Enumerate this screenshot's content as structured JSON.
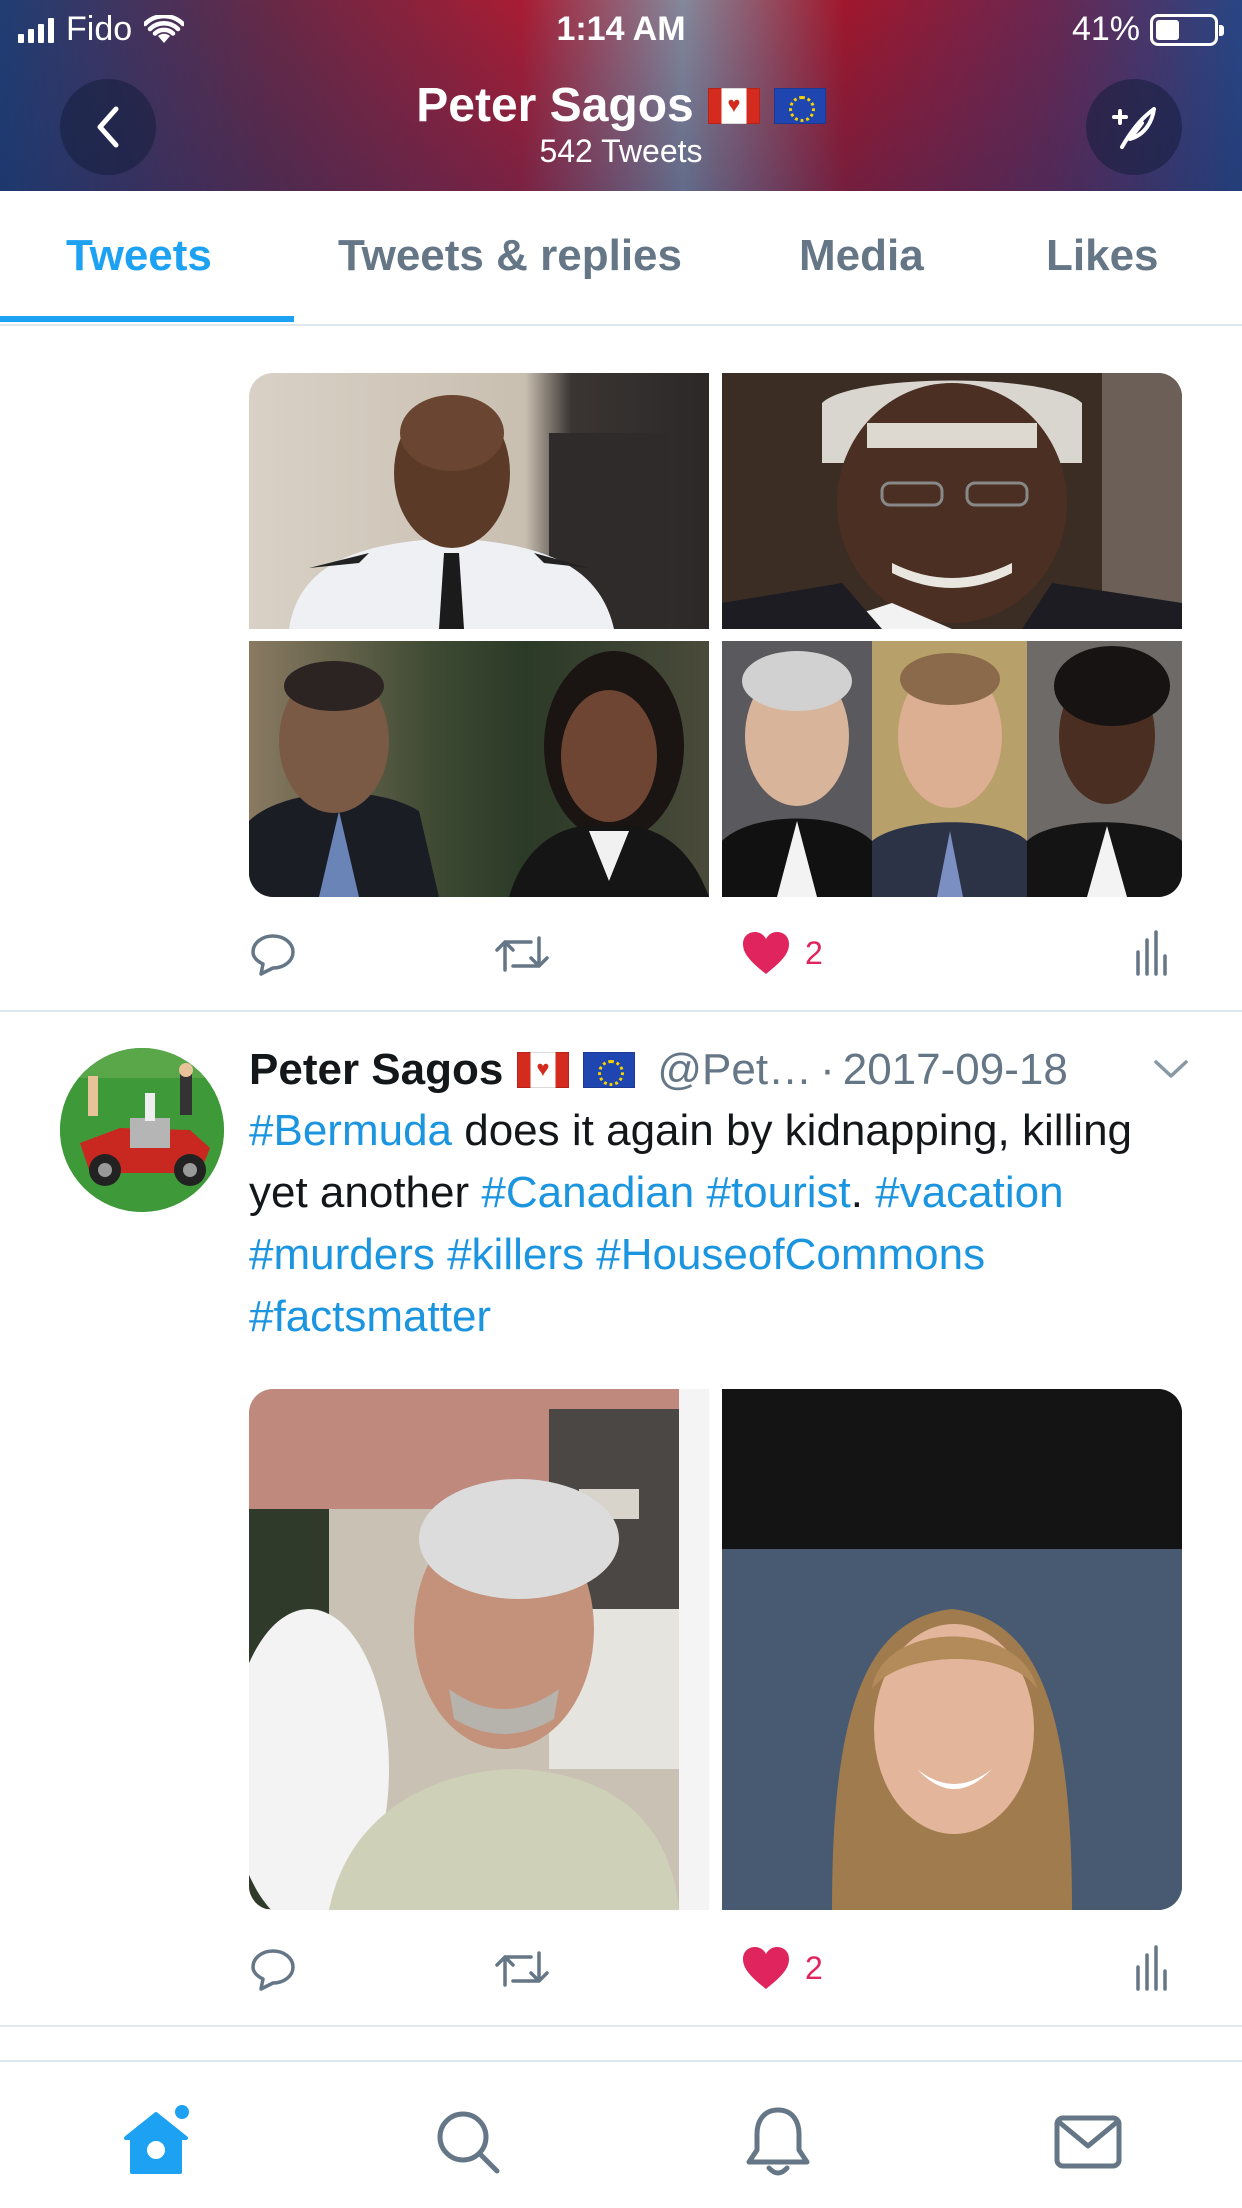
{
  "status_bar": {
    "carrier": "Fido",
    "time": "1:14 AM",
    "battery": "41%",
    "battery_level": 0.41
  },
  "header": {
    "name": "Peter Sagos",
    "tweet_count": "542 Tweets",
    "flags": [
      "canada-flag",
      "eu-flag"
    ]
  },
  "tabs": [
    {
      "label": "Tweets",
      "active": true
    },
    {
      "label": "Tweets & replies",
      "active": false
    },
    {
      "label": "Media",
      "active": false
    },
    {
      "label": "Likes",
      "active": false
    }
  ],
  "tweets": [
    {
      "images": [
        "photo-officer-uniform",
        "photo-judge-wig",
        "photo-man-and-woman",
        "photo-three-lawyers"
      ],
      "actions": {
        "reply": "",
        "retweet": "",
        "likes": "2"
      }
    },
    {
      "author": "Peter Sagos",
      "handle": "@Pet…",
      "separator": "·",
      "date": "2017-09-18",
      "text_segments": [
        {
          "text": "#Bermuda",
          "hashtag": true
        },
        {
          "text": " does it again by kidnapping, killing yet another ",
          "hashtag": false
        },
        {
          "text": "#Canadian",
          "hashtag": true
        },
        {
          "text": " ",
          "hashtag": false
        },
        {
          "text": "#tourist",
          "hashtag": true
        },
        {
          "text": ". ",
          "hashtag": false
        },
        {
          "text": "#vacation",
          "hashtag": true
        },
        {
          "text": " ",
          "hashtag": false
        },
        {
          "text": "#murders",
          "hashtag": true
        },
        {
          "text": " ",
          "hashtag": false
        },
        {
          "text": "#killers",
          "hashtag": true
        },
        {
          "text": " ",
          "hashtag": false
        },
        {
          "text": "#HouseofCommons",
          "hashtag": true
        },
        {
          "text": " ",
          "hashtag": false
        },
        {
          "text": "#factsmatter",
          "hashtag": true
        }
      ],
      "images": [
        "photo-older-man",
        "photo-young-woman"
      ],
      "actions": {
        "reply": "",
        "retweet": "",
        "likes": "2"
      }
    }
  ],
  "bottom_nav": [
    "home-icon",
    "search-icon",
    "notifications-icon",
    "messages-icon"
  ],
  "colors": {
    "accent": "#1da1f2",
    "like": "#e0245e",
    "hashtag": "#1b95e0",
    "muted": "#657786"
  }
}
